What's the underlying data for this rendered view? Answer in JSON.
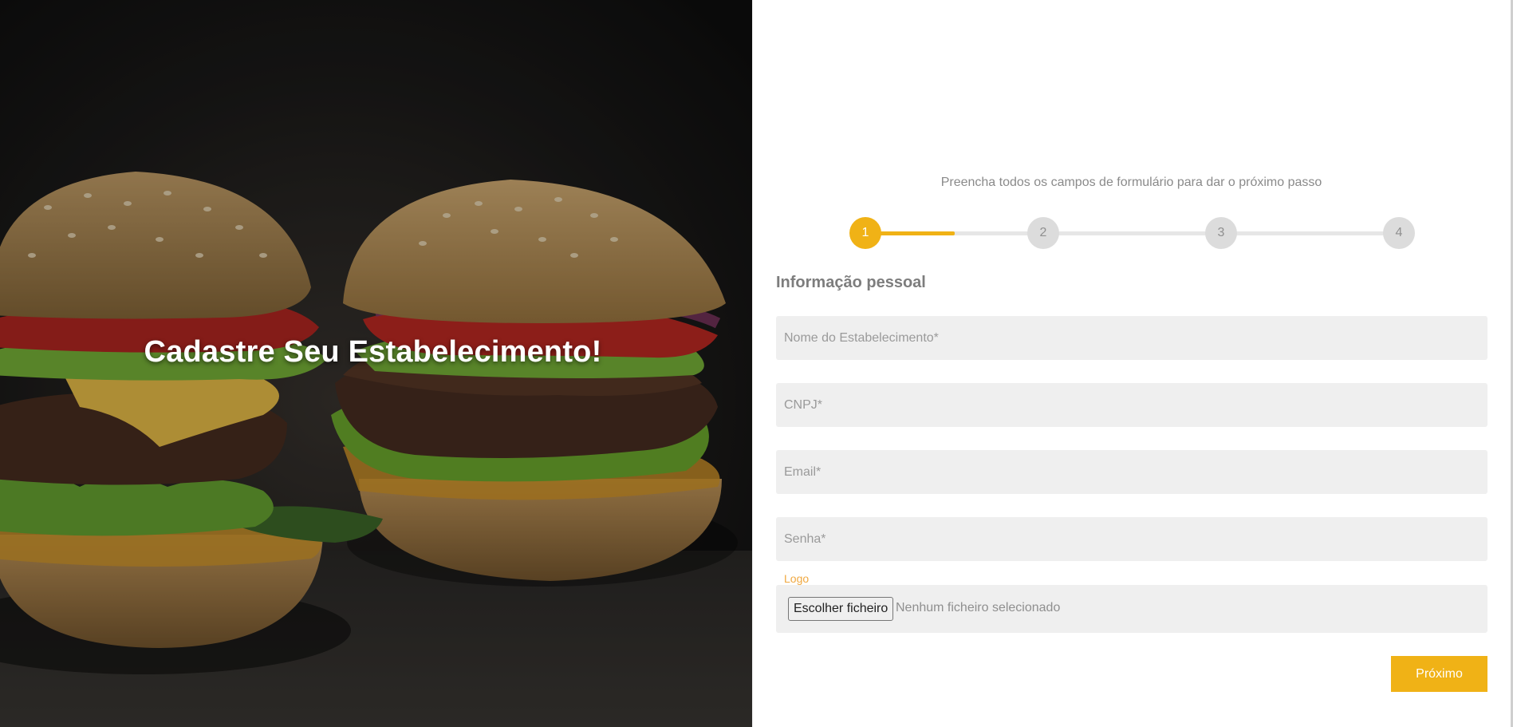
{
  "hero": {
    "title": "Cadastre Seu Estabelecimento!"
  },
  "form": {
    "instruction": "Preencha todos os campos de formulário para dar o próximo passo",
    "steps": [
      "1",
      "2",
      "3",
      "4"
    ],
    "active_step": 1,
    "section_title": "Informação pessoal",
    "fields": {
      "name_placeholder": "Nome do Estabelecimento*",
      "cnpj_placeholder": "CNPJ*",
      "email_placeholder": "Email*",
      "password_placeholder": "Senha*"
    },
    "logo": {
      "label": "Logo",
      "button_label": "Escolher ficheiro",
      "status": "Nenhum ficheiro selecionado"
    },
    "next_label": "Próximo"
  },
  "colors": {
    "accent": "#f0b216",
    "field_bg": "#efefef",
    "logo_label": "#f0a840"
  },
  "icons": {
    "hero_image": "burger-photo"
  }
}
